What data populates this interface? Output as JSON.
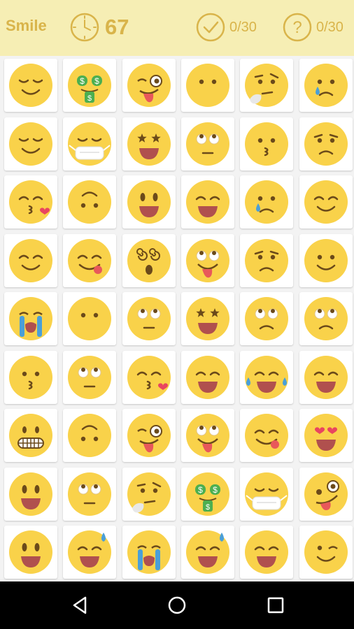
{
  "header": {
    "category": "Smile",
    "timer_value": "67",
    "found_count": "0/30",
    "hint_count": "0/30",
    "accent_color": "#d9b44a",
    "header_bg": "#f6eeb4",
    "icons": [
      "clock-icon",
      "check-circle-icon",
      "question-circle-icon"
    ]
  },
  "grid": {
    "columns": 6,
    "rows": 9,
    "tiles": [
      "relieved",
      "money-mouth",
      "wink-tongue",
      "no-mouth",
      "thinking",
      "sad-tear",
      "relieved",
      "mask",
      "star-struck",
      "roll-eyes",
      "kissing",
      "worried",
      "kissing-heart",
      "upside-down",
      "smiley",
      "grin",
      "sad-tear",
      "blush",
      "blush",
      "yum",
      "dizzy",
      "crazy",
      "worried",
      "slight-smile",
      "loudly-crying",
      "no-mouth",
      "roll-eyes",
      "star-struck",
      "roll-frown",
      "roll-frown",
      "kissing",
      "roll-eyes",
      "kissing-heart",
      "grin",
      "joy",
      "grin",
      "grimace",
      "upside-down",
      "wink-tongue",
      "crazy",
      "yum",
      "heart-eyes",
      "smiley",
      "roll-eyes",
      "thinking",
      "money-mouth",
      "mask",
      "zany",
      "smiley",
      "sweat-smile",
      "loudly-crying",
      "sweat-smile",
      "grin",
      "wink"
    ]
  },
  "navbar": {
    "icons": [
      "back-icon",
      "home-icon",
      "recents-icon"
    ]
  }
}
